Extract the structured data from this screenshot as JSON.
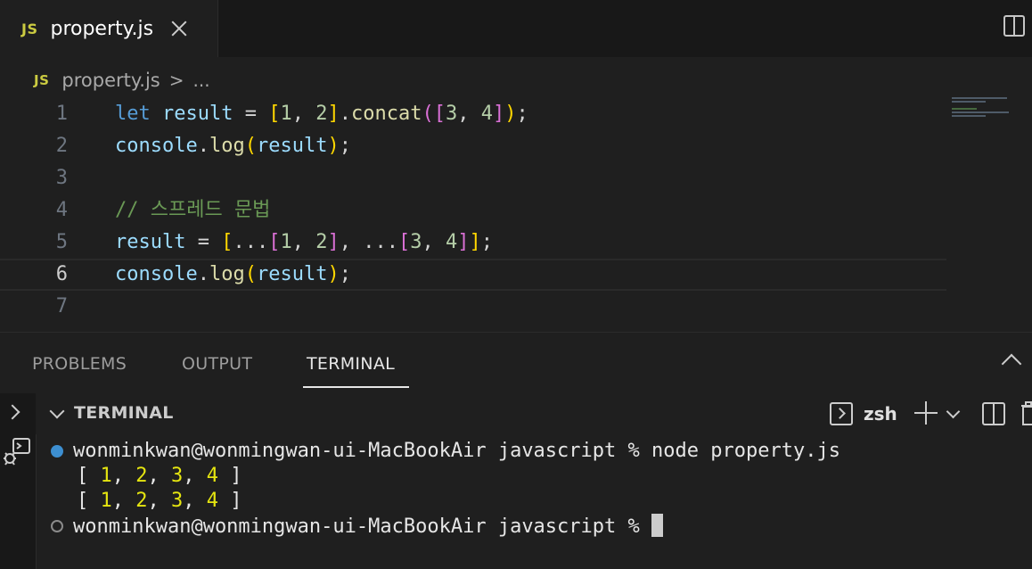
{
  "editor_tab": {
    "badge": "JS",
    "label": "property.js"
  },
  "breadcrumb": {
    "badge": "JS",
    "file": "property.js",
    "separator": ">",
    "more": "..."
  },
  "code_lines": [
    {
      "n": "1",
      "tokens": [
        {
          "t": "let",
          "c": "kw"
        },
        {
          "t": " ",
          "c": "op"
        },
        {
          "t": "result",
          "c": "var"
        },
        {
          "t": " = ",
          "c": "op"
        },
        {
          "t": "[",
          "c": "b1"
        },
        {
          "t": "1",
          "c": "num"
        },
        {
          "t": ", ",
          "c": "op"
        },
        {
          "t": "2",
          "c": "num"
        },
        {
          "t": "]",
          "c": "b1"
        },
        {
          "t": ".",
          "c": "op"
        },
        {
          "t": "concat",
          "c": "fn"
        },
        {
          "t": "(",
          "c": "b2"
        },
        {
          "t": "[",
          "c": "b2"
        },
        {
          "t": "3",
          "c": "num"
        },
        {
          "t": ", ",
          "c": "op"
        },
        {
          "t": "4",
          "c": "num"
        },
        {
          "t": "]",
          "c": "b2"
        },
        {
          "t": ")",
          "c": "b1"
        },
        {
          "t": ";",
          "c": "op"
        }
      ]
    },
    {
      "n": "2",
      "tokens": [
        {
          "t": "console",
          "c": "var"
        },
        {
          "t": ".",
          "c": "op"
        },
        {
          "t": "log",
          "c": "fn"
        },
        {
          "t": "(",
          "c": "b1"
        },
        {
          "t": "result",
          "c": "var"
        },
        {
          "t": ")",
          "c": "b1"
        },
        {
          "t": ";",
          "c": "op"
        }
      ]
    },
    {
      "n": "3",
      "tokens": []
    },
    {
      "n": "4",
      "tokens": [
        {
          "t": "// 스프레드 문법",
          "c": "cmt"
        }
      ]
    },
    {
      "n": "5",
      "tokens": [
        {
          "t": "result",
          "c": "var"
        },
        {
          "t": " = ",
          "c": "op"
        },
        {
          "t": "[",
          "c": "b1"
        },
        {
          "t": "...",
          "c": "op"
        },
        {
          "t": "[",
          "c": "b2"
        },
        {
          "t": "1",
          "c": "num"
        },
        {
          "t": ", ",
          "c": "op"
        },
        {
          "t": "2",
          "c": "num"
        },
        {
          "t": "]",
          "c": "b2"
        },
        {
          "t": ", ...",
          "c": "op"
        },
        {
          "t": "[",
          "c": "b2"
        },
        {
          "t": "3",
          "c": "num"
        },
        {
          "t": ", ",
          "c": "op"
        },
        {
          "t": "4",
          "c": "num"
        },
        {
          "t": "]",
          "c": "b2"
        },
        {
          "t": "]",
          "c": "b1"
        },
        {
          "t": ";",
          "c": "op"
        }
      ]
    },
    {
      "n": "6",
      "tokens": [
        {
          "t": "console",
          "c": "var"
        },
        {
          "t": ".",
          "c": "op"
        },
        {
          "t": "log",
          "c": "fn"
        },
        {
          "t": "(",
          "c": "b1"
        },
        {
          "t": "result",
          "c": "var"
        },
        {
          "t": ")",
          "c": "b1"
        },
        {
          "t": ";",
          "c": "op"
        }
      ]
    },
    {
      "n": "7",
      "tokens": []
    }
  ],
  "current_line": "6",
  "panel_tabs": [
    {
      "label": "PROBLEMS",
      "active": false
    },
    {
      "label": "OUTPUT",
      "active": false
    },
    {
      "label": "TERMINAL",
      "active": true
    }
  ],
  "terminal": {
    "title": "TERMINAL",
    "shell": "zsh",
    "command_line": "wonminkwan@wonmingwan-ui-MacBookAir javascript % node property.js",
    "prompt_line": "wonminkwan@wonmingwan-ui-MacBookAir javascript % ",
    "output": [
      {
        "prefix": "[ ",
        "values": [
          "1",
          "2",
          "3",
          "4"
        ],
        "suffix": " ]"
      },
      {
        "prefix": "[ ",
        "values": [
          "1",
          "2",
          "3",
          "4"
        ],
        "suffix": " ]"
      }
    ]
  },
  "colors": {
    "keyword": "#569cd6",
    "variable": "#9cdcfe",
    "function": "#dcdcaa",
    "number": "#b5cea8",
    "comment": "#6a9955",
    "bracket_gold": "#ffd700",
    "bracket_purple": "#da70d6",
    "terminal_number": "#e5e510",
    "success_dot": "#3d8fd1"
  },
  "icons": {
    "split_editor": "split-editor-icon",
    "collapse_panel": "chevron-up-icon",
    "new_terminal": "plus-icon",
    "kill_terminal": "trash-icon"
  }
}
